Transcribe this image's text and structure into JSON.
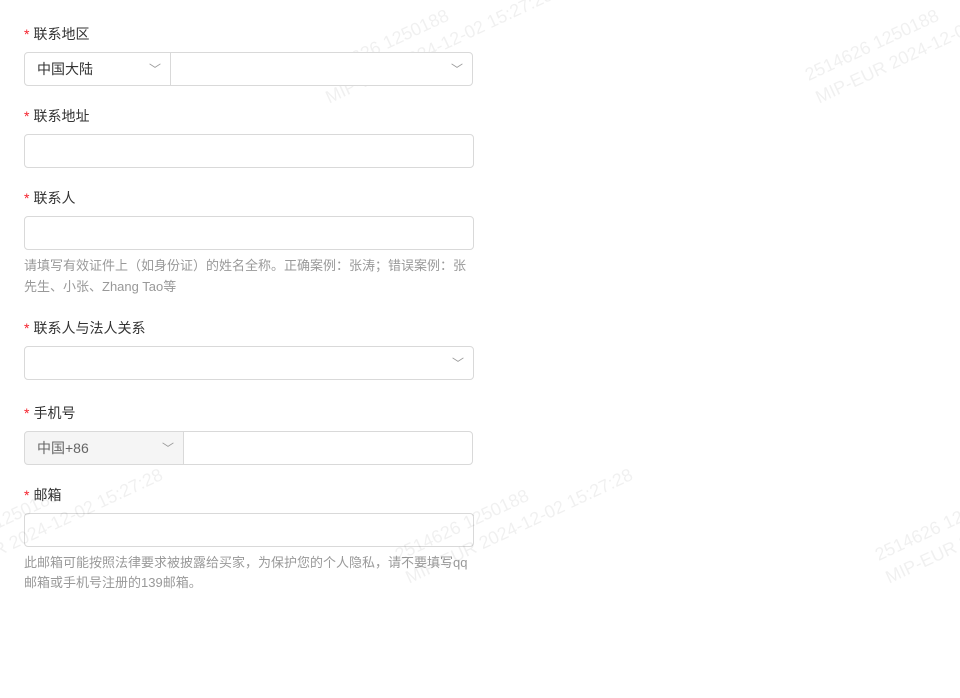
{
  "watermark": {
    "line1": "2514626 1250188",
    "line2": "MIP-EUR 2024-12-02 15:27:28"
  },
  "fields": {
    "region": {
      "label": "联系地区",
      "country_value": "中国大陆"
    },
    "address": {
      "label": "联系地址"
    },
    "contact": {
      "label": "联系人",
      "hint": "请填写有效证件上（如身份证）的姓名全称。正确案例：张涛；错误案例：张先生、小张、Zhang Tao等"
    },
    "relation": {
      "label": "联系人与法人关系"
    },
    "phone": {
      "label": "手机号",
      "prefix": "中国+86"
    },
    "email": {
      "label": "邮箱",
      "hint": "此邮箱可能按照法律要求被披露给买家，为保护您的个人隐私，请不要填写qq邮箱或手机号注册的139邮箱。"
    }
  }
}
